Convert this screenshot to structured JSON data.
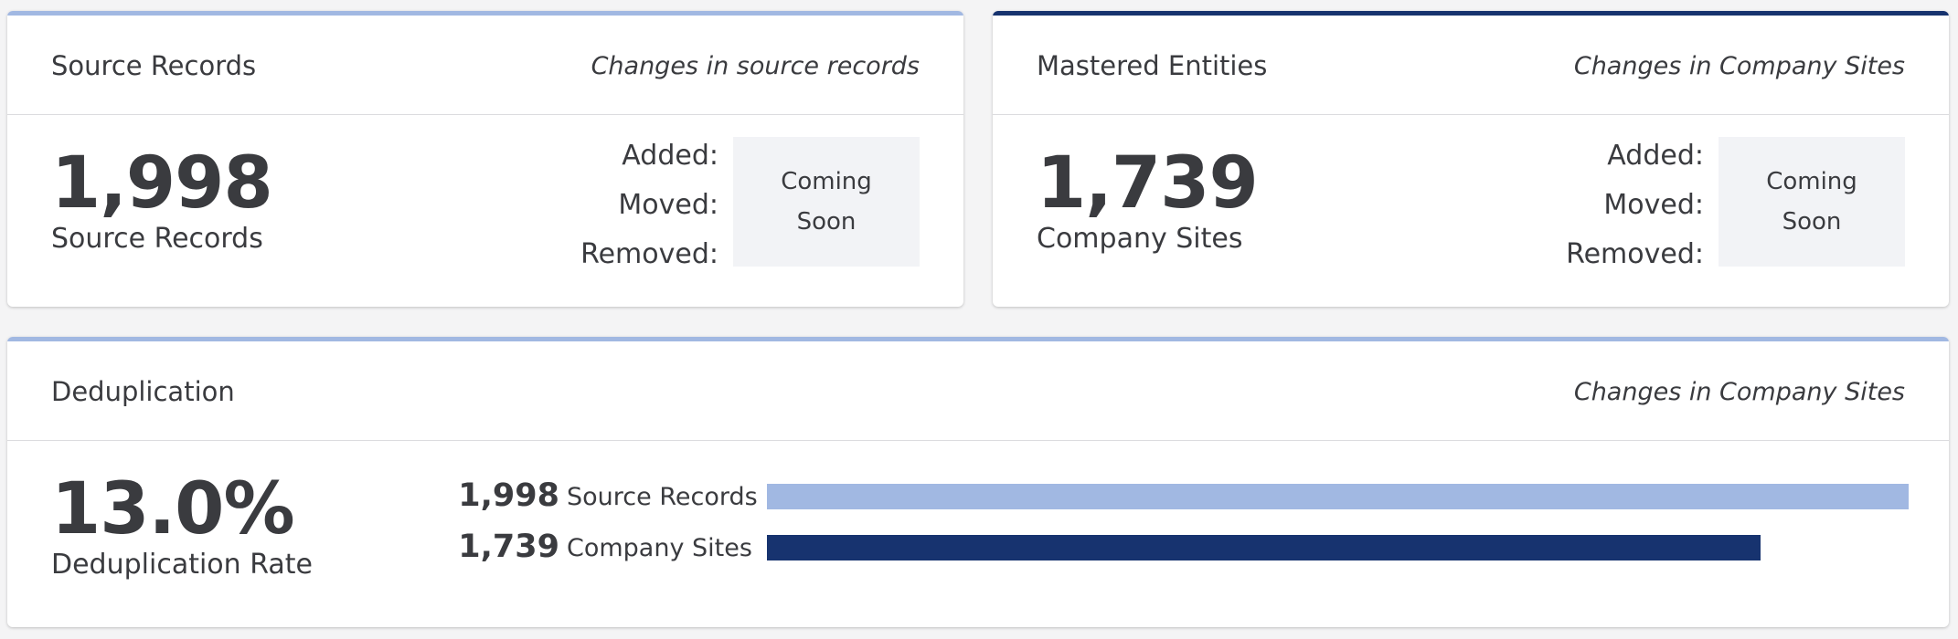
{
  "colors": {
    "light_blue": "#a1b8e2",
    "dark_navy": "#17336f"
  },
  "source_card": {
    "title": "Source Records",
    "subtitle": "Changes in source records",
    "value": "1,998",
    "value_label": "Source Records",
    "changes": {
      "added_label": "Added:",
      "moved_label": "Moved:",
      "removed_label": "Removed:"
    },
    "coming_soon": {
      "line1": "Coming",
      "line2": "Soon"
    }
  },
  "mastered_card": {
    "title": "Mastered Entities",
    "subtitle": "Changes in Company Sites",
    "value": "1,739",
    "value_label": "Company Sites",
    "changes": {
      "added_label": "Added:",
      "moved_label": "Moved:",
      "removed_label": "Removed:"
    },
    "coming_soon": {
      "line1": "Coming",
      "line2": "Soon"
    }
  },
  "dedup_card": {
    "title": "Deduplication",
    "subtitle": "Changes in Company Sites",
    "value": "13.0%",
    "value_label": "Deduplication Rate",
    "bars": [
      {
        "count": "1,998",
        "label": "Source Records",
        "value": 1998,
        "color_key": "light_blue"
      },
      {
        "count": "1,739",
        "label": "Company Sites",
        "value": 1739,
        "color_key": "dark_navy"
      }
    ]
  }
}
